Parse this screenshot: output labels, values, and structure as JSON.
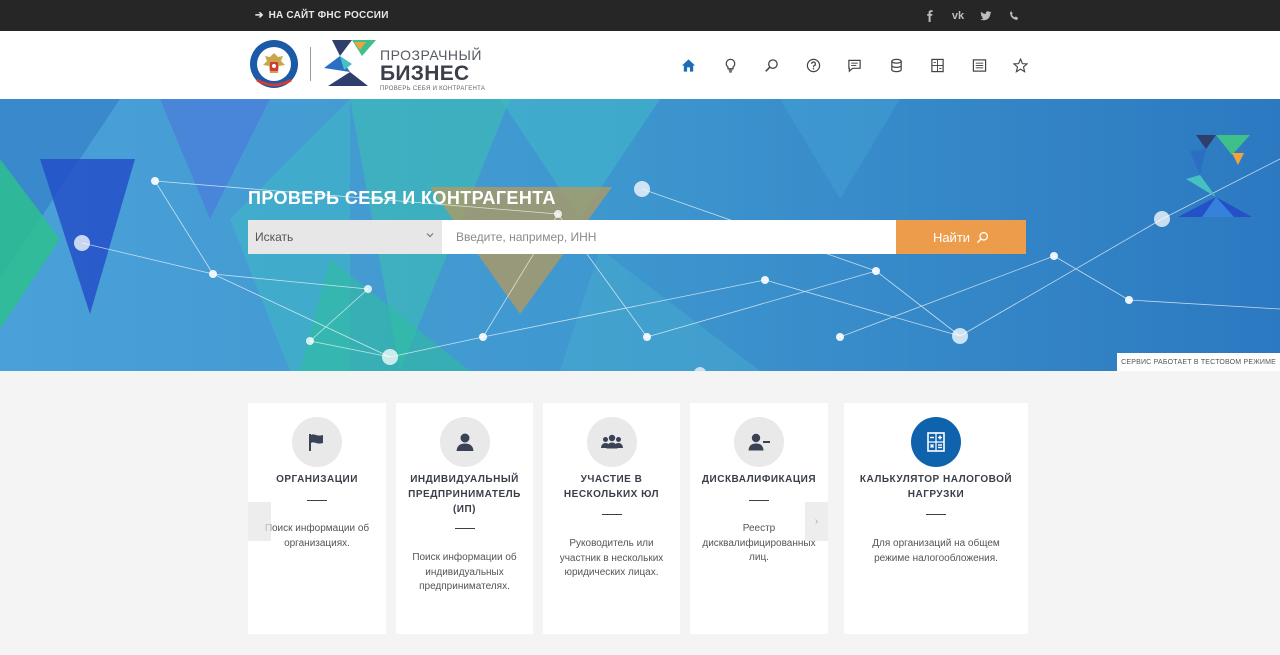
{
  "topbar": {
    "back_link": "НА САЙТ ФНС РОССИИ",
    "social": [
      "facebook-icon",
      "vk-icon",
      "twitter-icon",
      "phone-icon"
    ],
    "vk_label": "vk"
  },
  "header": {
    "brand_line1": "ПРОЗРАЧНЫЙ",
    "brand_line2": "БИЗНЕС",
    "brand_line3": "ПРОВЕРЬ СЕБЯ И КОНТРАГЕНТА",
    "nav": [
      "home-icon",
      "lightbulb-icon",
      "search-icon",
      "help-icon",
      "chat-icon",
      "database-icon",
      "calculator-icon",
      "list-icon",
      "star-icon"
    ]
  },
  "hero": {
    "title": "ПРОВЕРЬ СЕБЯ И КОНТРАГЕНТА",
    "select_value": "Искать",
    "search_placeholder": "Введите, например, ИНН",
    "search_button": "Найти",
    "test_badge": "СЕРВИС РАБОТАЕТ В ТЕСТОВОМ РЕЖИМЕ"
  },
  "cards": [
    {
      "title": "ОРГАНИЗАЦИИ",
      "desc": "Поиск информации об\nорганизациях.",
      "icon": "flag-icon"
    },
    {
      "title": "ИНДИВИДУАЛЬНЫЙ\nПРЕДПРИНИМАТЕЛЬ\n(ИП)",
      "desc": "Поиск информации об\nиндивидуальных\nпредпринимателях.",
      "icon": "user-icon"
    },
    {
      "title": "УЧАСТИЕ В\nНЕСКОЛЬКИХ ЮЛ",
      "desc": "Руководитель или\nучастник в нескольких\nюридических лицах.",
      "icon": "users-icon"
    },
    {
      "title": "ДИСКВАЛИФИКАЦИЯ",
      "desc": "Реестр\nдисквалифицированных\nлиц.",
      "icon": "user-minus-icon"
    },
    {
      "title": "КАЛЬКУЛЯТОР НАЛОГОВОЙ\nНАГРУЗКИ",
      "desc": "Для организаций на общем\nрежиме налогообложения.",
      "icon": "calculator-icon"
    }
  ],
  "colors": {
    "accent_orange": "#ec9c4a",
    "brand_blue": "#0f62ac",
    "nav_active": "#1e6bb8",
    "dark_bar": "#262626"
  }
}
